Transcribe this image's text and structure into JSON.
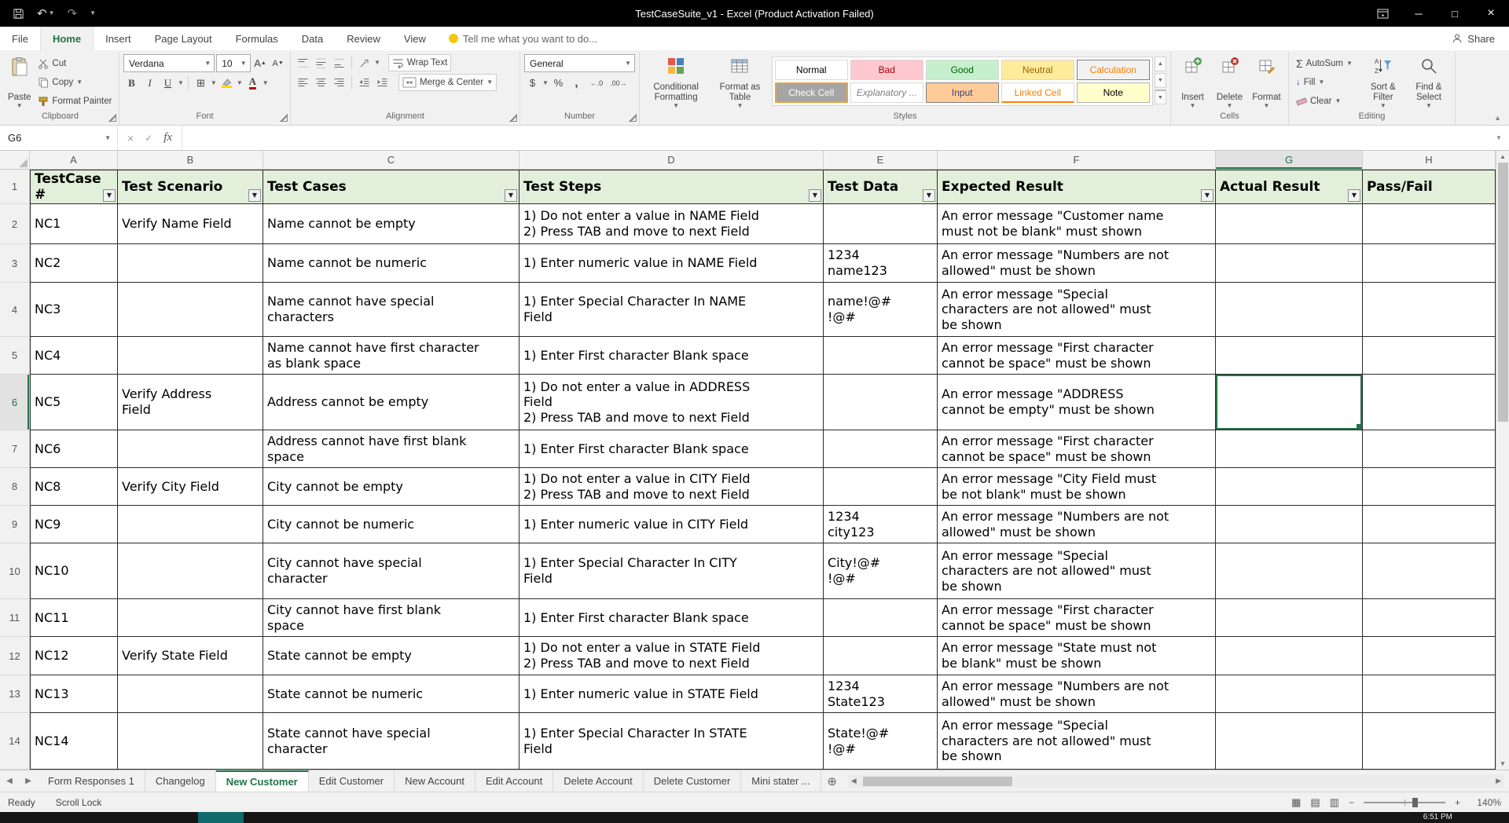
{
  "window": {
    "title": "TestCaseSuite_v1 - Excel (Product Activation Failed)"
  },
  "ribbon_tabs": {
    "items": [
      "File",
      "Home",
      "Insert",
      "Page Layout",
      "Formulas",
      "Data",
      "Review",
      "View"
    ],
    "active": "Home",
    "tell_me": "Tell me what you want to do...",
    "share": "Share"
  },
  "ribbon": {
    "clipboard": {
      "label": "Clipboard",
      "paste": "Paste",
      "cut": "Cut",
      "copy": "Copy",
      "format_painter": "Format Painter"
    },
    "font": {
      "label": "Font",
      "font_name": "Verdana",
      "font_size": "10"
    },
    "alignment": {
      "label": "Alignment",
      "wrap_text": "Wrap Text",
      "merge_center": "Merge & Center"
    },
    "number": {
      "label": "Number",
      "format": "General"
    },
    "styles": {
      "label": "Styles",
      "conditional_formatting": "Conditional Formatting",
      "format_as_table": "Format as Table",
      "selected_style": "Check Cell",
      "gallery": [
        {
          "name": "Normal",
          "bg": "#FFFFFF",
          "fg": "#000000"
        },
        {
          "name": "Bad",
          "bg": "#FFC7CE",
          "fg": "#9C0006"
        },
        {
          "name": "Good",
          "bg": "#C6EFCE",
          "fg": "#006100"
        },
        {
          "name": "Neutral",
          "bg": "#FFEB9C",
          "fg": "#9C6500"
        },
        {
          "name": "Calculation",
          "bg": "#F2F2F2",
          "fg": "#FA7D00"
        },
        {
          "name": "Check Cell",
          "bg": "#A5A5A5",
          "fg": "#FFFFFF"
        },
        {
          "name": "Explanatory ...",
          "bg": "#FFFFFF",
          "fg": "#7F7F7F"
        },
        {
          "name": "Input",
          "bg": "#FFCC99",
          "fg": "#3F3F76"
        },
        {
          "name": "Linked Cell",
          "bg": "#FFFFFF",
          "fg": "#FA7D00"
        },
        {
          "name": "Note",
          "bg": "#FFFFCC",
          "fg": "#000000"
        }
      ]
    },
    "cells": {
      "label": "Cells",
      "insert": "Insert",
      "delete": "Delete",
      "format": "Format"
    },
    "editing": {
      "label": "Editing",
      "autosum": "AutoSum",
      "fill": "Fill",
      "clear": "Clear",
      "sort_filter": "Sort & Filter",
      "find_select": "Find & Select"
    }
  },
  "formula_bar": {
    "name_box": "G6",
    "formula": ""
  },
  "sheet": {
    "columns": [
      "A",
      "B",
      "C",
      "D",
      "E",
      "F",
      "G",
      "H"
    ],
    "selected_cell": "G6",
    "row_numbers": [
      "1",
      "2",
      "3",
      "4",
      "5",
      "6",
      "7",
      "8",
      "9",
      "10",
      "11",
      "12",
      "13",
      "14"
    ],
    "header": {
      "a": "TestCase\n#",
      "b": "Test Scenario",
      "c": "Test Cases",
      "d": "Test Steps",
      "e": "Test Data",
      "f": "Expected Result",
      "g": "Actual Result",
      "h": "Pass/Fail"
    },
    "rows": [
      {
        "a": "NC1",
        "b": "Verify Name Field",
        "c": "Name cannot be empty",
        "d": "1) Do not enter a value in NAME Field\n2) Press TAB and move to next Field",
        "e": "",
        "f": "An error message \"Customer name\nmust not be blank\" must shown",
        "g": "",
        "h": ""
      },
      {
        "a": "NC2",
        "b": "",
        "c": "Name cannot be numeric",
        "d": "1) Enter numeric value in NAME Field",
        "e": "1234\nname123",
        "f": "An error message \"Numbers are not\nallowed\" must be shown",
        "g": "",
        "h": ""
      },
      {
        "a": "NC3",
        "b": "",
        "c": "Name cannot have special\ncharacters",
        "d": "1) Enter Special Character In NAME\nField",
        "e": "name!@#\n!@#",
        "f": "An error message \"Special\ncharacters are not allowed\" must\nbe shown",
        "g": "",
        "h": ""
      },
      {
        "a": "NC4",
        "b": "",
        "c": "Name cannot have first character\nas blank space",
        "d": "1) Enter First character Blank space",
        "e": "",
        "f": "An error message \"First character\ncannot be space\" must be shown",
        "g": "",
        "h": ""
      },
      {
        "a": "NC5",
        "b": "Verify Address\nField",
        "c": "Address cannot be empty",
        "d": "1) Do not enter a value in ADDRESS\nField\n2) Press TAB and move to next Field",
        "e": "",
        "f": "An error message \"ADDRESS\ncannot be empty\" must be shown",
        "g": "",
        "h": ""
      },
      {
        "a": "NC6",
        "b": "",
        "c": "Address cannot have first blank\nspace",
        "d": "1) Enter First character Blank space",
        "e": "",
        "f": "An error message \"First character\ncannot be space\" must be shown",
        "g": "",
        "h": ""
      },
      {
        "a": "NC8",
        "b": "Verify City Field",
        "c": "City cannot be empty",
        "d": "1) Do not enter a value in CITY Field\n2) Press TAB and move to next Field",
        "e": "",
        "f": "An error message \"City Field must\nbe not blank\" must be shown",
        "g": "",
        "h": ""
      },
      {
        "a": "NC9",
        "b": "",
        "c": "City cannot be numeric",
        "d": "1) Enter numeric value in CITY Field",
        "e": "1234\ncity123",
        "f": "An error message \"Numbers are not\nallowed\" must be shown",
        "g": "",
        "h": ""
      },
      {
        "a": "NC10",
        "b": "",
        "c": "City cannot have special\ncharacter",
        "d": "1) Enter Special Character In CITY\nField",
        "e": "City!@#\n!@#",
        "f": "An error message \"Special\ncharacters are not allowed\" must\nbe shown",
        "g": "",
        "h": ""
      },
      {
        "a": "NC11",
        "b": "",
        "c": "City cannot have first blank\nspace",
        "d": "1) Enter First character Blank space",
        "e": "",
        "f": "An error message \"First character\ncannot be space\" must be shown",
        "g": "",
        "h": ""
      },
      {
        "a": "NC12",
        "b": "Verify State Field",
        "c": "State cannot be empty",
        "d": "1) Do not enter a value in STATE Field\n2) Press TAB and move to next Field",
        "e": "",
        "f": "An error message \"State must not\nbe blank\" must be shown",
        "g": "",
        "h": ""
      },
      {
        "a": "NC13",
        "b": "",
        "c": "State cannot be numeric",
        "d": "1) Enter numeric value in STATE Field",
        "e": "1234\nState123",
        "f": "An error message \"Numbers are not\nallowed\" must be shown",
        "g": "",
        "h": ""
      },
      {
        "a": "NC14",
        "b": "",
        "c": "State cannot have special\ncharacter",
        "d": "1) Enter Special Character In STATE\nField",
        "e": "State!@#\n!@#",
        "f": "An error message \"Special\ncharacters are not allowed\" must\nbe shown",
        "g": "",
        "h": ""
      }
    ]
  },
  "sheet_tabs": {
    "items": [
      "Form Responses 1",
      "Changelog",
      "New Customer",
      "Edit Customer",
      "New Account",
      "Edit Account",
      "Delete Account",
      "Delete Customer",
      "Mini stater ..."
    ],
    "active": "New Customer"
  },
  "status_bar": {
    "mode": "Ready",
    "scroll_lock": "Scroll Lock",
    "zoom": "140%"
  },
  "taskbar": {
    "time": "6:51 PM"
  },
  "colors": {
    "accent_green": "#217346",
    "table_header_fill": "#E2EFDA",
    "selection_border": "#217346",
    "titlebar_bg": "#000000"
  }
}
